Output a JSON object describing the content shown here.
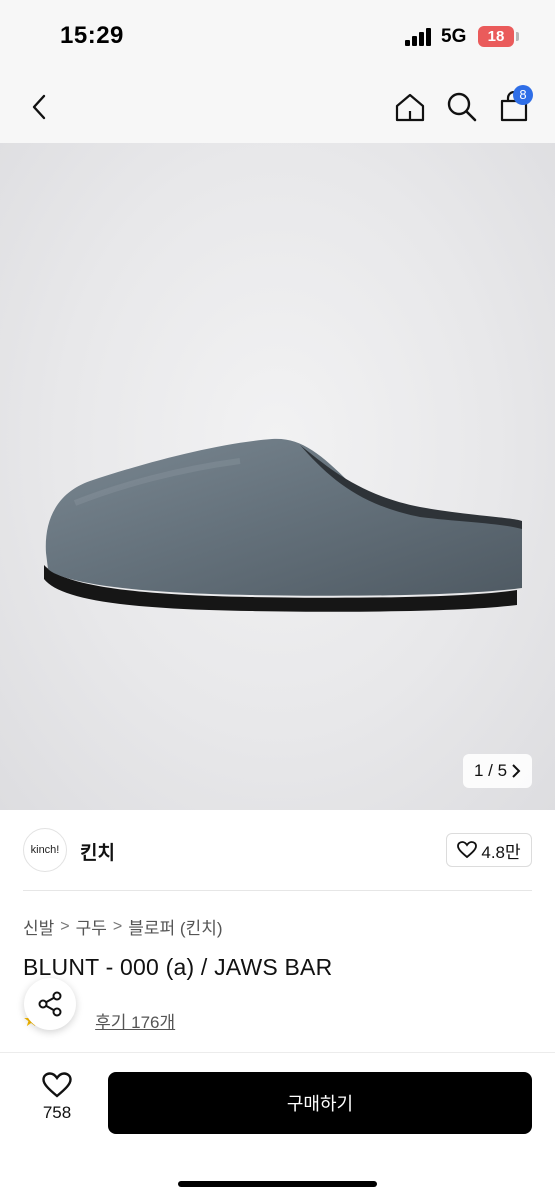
{
  "status_bar": {
    "time": "15:29",
    "network": "5G",
    "battery": "18"
  },
  "nav": {
    "cart_count": "8",
    "icons": [
      "back-icon",
      "home-icon",
      "search-icon",
      "cart-icon"
    ]
  },
  "gallery": {
    "current": "1",
    "total": "5",
    "counter_text": "1 / 5"
  },
  "brand": {
    "logo_text": "kinch!",
    "name": "킨치",
    "likes": "4.8만"
  },
  "breadcrumb": [
    "신발",
    "구두",
    "블로퍼 (킨치)"
  ],
  "product": {
    "title": "BLUNT - 000 (a) / JAWS BAR",
    "review_text": "후기 176개"
  },
  "bottom": {
    "wishlist_count": "758",
    "buy_label": "구매하기"
  },
  "colors": {
    "buy_button": "#000000",
    "badge": "#2f6ee7",
    "battery": "#ea5b5b",
    "star": "#f5b800"
  }
}
